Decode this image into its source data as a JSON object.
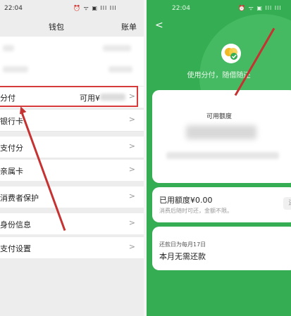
{
  "left": {
    "status_time": "22:04",
    "status_icons": "⏰ ᯤ ▣ Ill Ill",
    "nav_title": "钱包",
    "nav_action": "账单",
    "rows": [
      {
        "label": "分付",
        "value": "可用¥"
      },
      {
        "label": "银行卡",
        "value": ""
      },
      {
        "label": "支付分",
        "value": ""
      },
      {
        "label": "亲属卡",
        "value": ""
      },
      {
        "label": "消费者保护",
        "value": ""
      },
      {
        "label": "身份信息",
        "value": ""
      },
      {
        "label": "支付设置",
        "value": ""
      }
    ],
    "chevron": ">"
  },
  "right": {
    "status_time": "22:04",
    "status_icons": "⏰ ᯤ ▣ Ill Ill",
    "back_icon": "<",
    "slogan": "使用分付，随借随还",
    "available_title": "可用额度",
    "used_label": "已用额度¥0.00",
    "used_note": "消费后随时可还，金额不限。",
    "repay_btn": "还",
    "repay_day": "还款日为每月17日",
    "repay_status": "本月无需还款"
  },
  "colors": {
    "green": "#35ad52",
    "red": "#c63232"
  }
}
